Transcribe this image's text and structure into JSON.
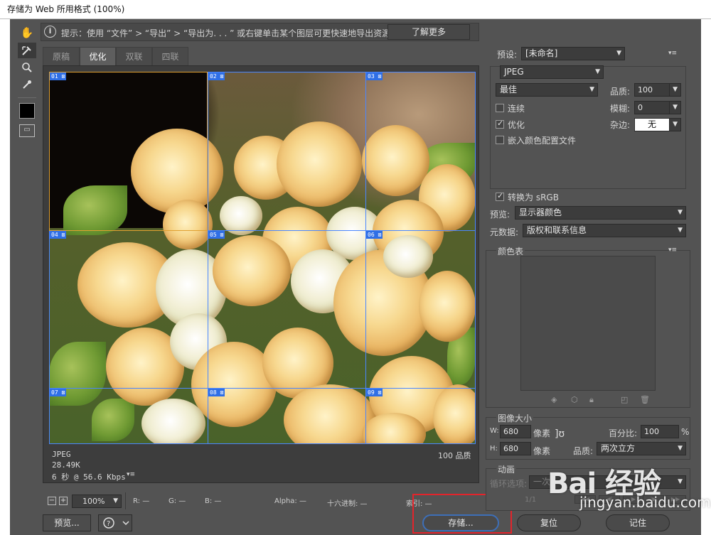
{
  "window": {
    "title": "存储为 Web 所用格式 (100%)"
  },
  "hint": {
    "text": "提示：使用 “文件” > “导出” > “导出为. . . ” 或右键单击某个图层可更快速地导出资源",
    "learn_more": "了解更多"
  },
  "tabs": [
    {
      "label": "原稿",
      "active": false
    },
    {
      "label": "优化",
      "active": true
    },
    {
      "label": "双联",
      "active": false
    },
    {
      "label": "四联",
      "active": false
    }
  ],
  "slices": [
    "01",
    "02",
    "03",
    "04",
    "05",
    "06",
    "07",
    "08",
    "09"
  ],
  "canvas_info": {
    "format": "JPEG",
    "size": "28.49K",
    "time": "6 秒 @ 56.6 Kbps",
    "quality": "100 品质"
  },
  "status": {
    "zoom": "100%",
    "r": "R: —",
    "g": "G: —",
    "b": "B: —",
    "alpha": "Alpha: —",
    "hex": "十六进制: —",
    "index": "索引: —"
  },
  "buttons": {
    "preview": "预览...",
    "save": "存储...",
    "reset": "复位",
    "remember": "记住"
  },
  "panel": {
    "preset_label": "预设:",
    "preset_value": "[未命名]",
    "format": "JPEG",
    "quality_preset": "最佳",
    "quality_label": "品质:",
    "quality_value": "100",
    "progressive": "连续",
    "blur_label": "模糊:",
    "blur_value": "0",
    "optimized": "优化",
    "matte_label": "杂边:",
    "matte_value": "无",
    "embed_profile": "嵌入颜色配置文件",
    "convert_srgb": "转换为 sRGB",
    "preview_label": "预览:",
    "preview_value": "显示器颜色",
    "metadata_label": "元数据:",
    "metadata_value": "版权和联系信息",
    "color_table": "颜色表",
    "image_size": "图像大小",
    "w_label": "W:",
    "w_value": "680",
    "h_label": "H:",
    "h_value": "680",
    "px_unit": "像素",
    "percent_label": "百分比:",
    "percent_value": "100",
    "percent_unit": "%",
    "resample_label": "品质:",
    "resample_value": "两次立方",
    "animation": "动画",
    "loop_label": "循环选项:",
    "loop_value": "一次",
    "frame_counter": "1/1"
  },
  "watermark": {
    "logo": "Bai 经验",
    "url": "jingyan.baidu.com"
  },
  "icons": {
    "hand": "hand-icon",
    "slice_select": "slice-select-icon",
    "zoom": "zoom-icon",
    "eyedropper": "eyedropper-icon",
    "info": "info-icon",
    "menu": "panel-menu-icon",
    "link": "link-icon"
  },
  "colors": {
    "accent_blue": "#4a86ff",
    "highlight_red": "#e3242b",
    "slice_selected": "#e0a030"
  }
}
